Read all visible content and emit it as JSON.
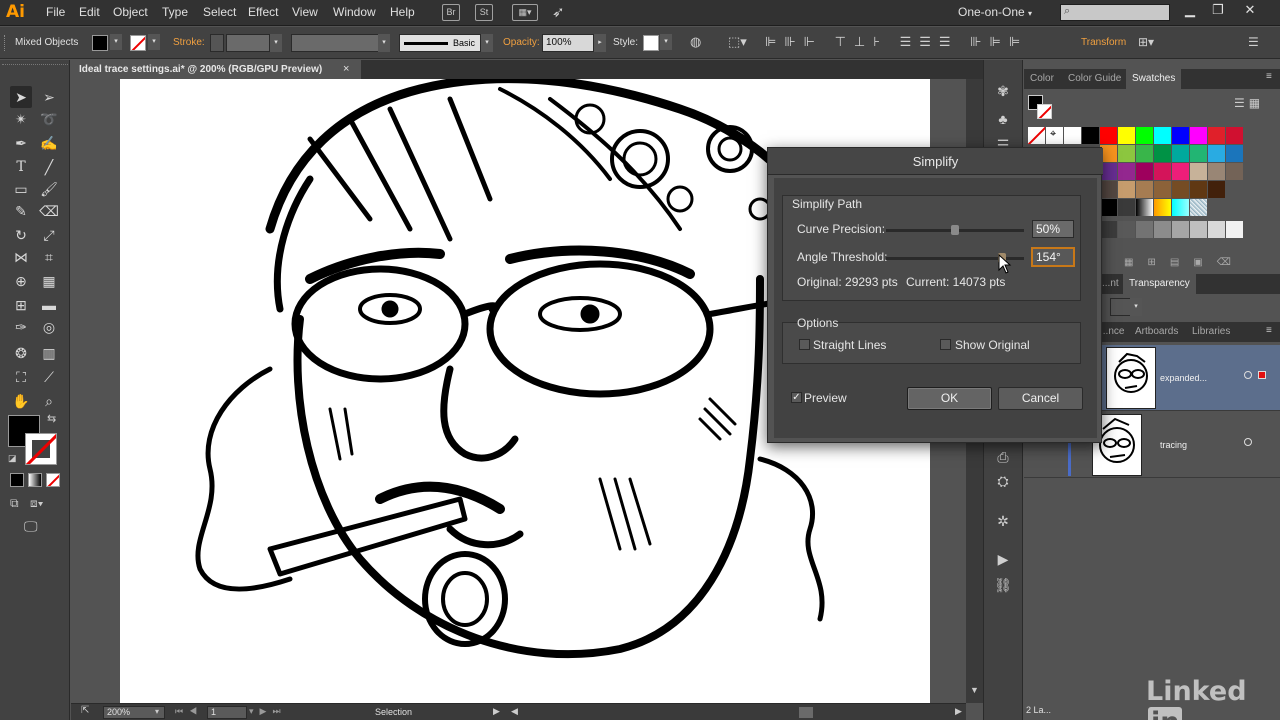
{
  "app": {
    "logo": "Ai"
  },
  "menu": {
    "items": [
      "File",
      "Edit",
      "Object",
      "Type",
      "Select",
      "Effect",
      "View",
      "Window",
      "Help"
    ],
    "bridge_label": "Br",
    "stock_label": "St",
    "workspace": "One-on-One"
  },
  "control_bar": {
    "selection_label": "Mixed Objects",
    "stroke_label": "Stroke:",
    "brush_label": "Basic",
    "opacity_label": "Opacity:",
    "opacity_value": "100%",
    "style_label": "Style:",
    "transform_label": "Transform"
  },
  "document": {
    "tab_title": "Ideal trace settings.ai* @ 200% (RGB/GPU Preview)",
    "close_glyph": "×"
  },
  "status_bar": {
    "zoom": "200%",
    "artboard": "1",
    "tool": "Selection"
  },
  "panels": {
    "swatch_tabs": [
      "Color",
      "Color Guide",
      "Swatches"
    ],
    "active_swatch_tab": "Swatches",
    "transparency_tabs": [
      "...nt",
      "Transparency"
    ],
    "layer_tabs": [
      "...nce",
      "Artboards",
      "Libraries"
    ],
    "layers": [
      {
        "name": "expanded...",
        "selected": true
      },
      {
        "name": "tracing",
        "selected": false
      }
    ],
    "layer_count": "2 La..."
  },
  "dialog": {
    "title": "Simplify",
    "group1_title": "Simplify Path",
    "curve_precision_label": "Curve Precision:",
    "curve_precision_value": "50%",
    "curve_precision_fraction": 0.5,
    "angle_threshold_label": "Angle Threshold:",
    "angle_threshold_value": "154°",
    "angle_threshold_fraction": 0.86,
    "original_label": "Original: 29293 pts",
    "current_label": "Current: 14073 pts",
    "options_title": "Options",
    "straight_lines_label": "Straight Lines",
    "straight_lines_checked": false,
    "show_original_label": "Show Original",
    "show_original_checked": false,
    "preview_label": "Preview",
    "preview_checked": true,
    "ok_label": "OK",
    "cancel_label": "Cancel"
  },
  "colors": {
    "accent_orange": "#f0a040",
    "focus_ring": "#c87818",
    "panel_bg": "#535353"
  },
  "watermark": {
    "brand": "Linked",
    "brand_in": "in"
  }
}
